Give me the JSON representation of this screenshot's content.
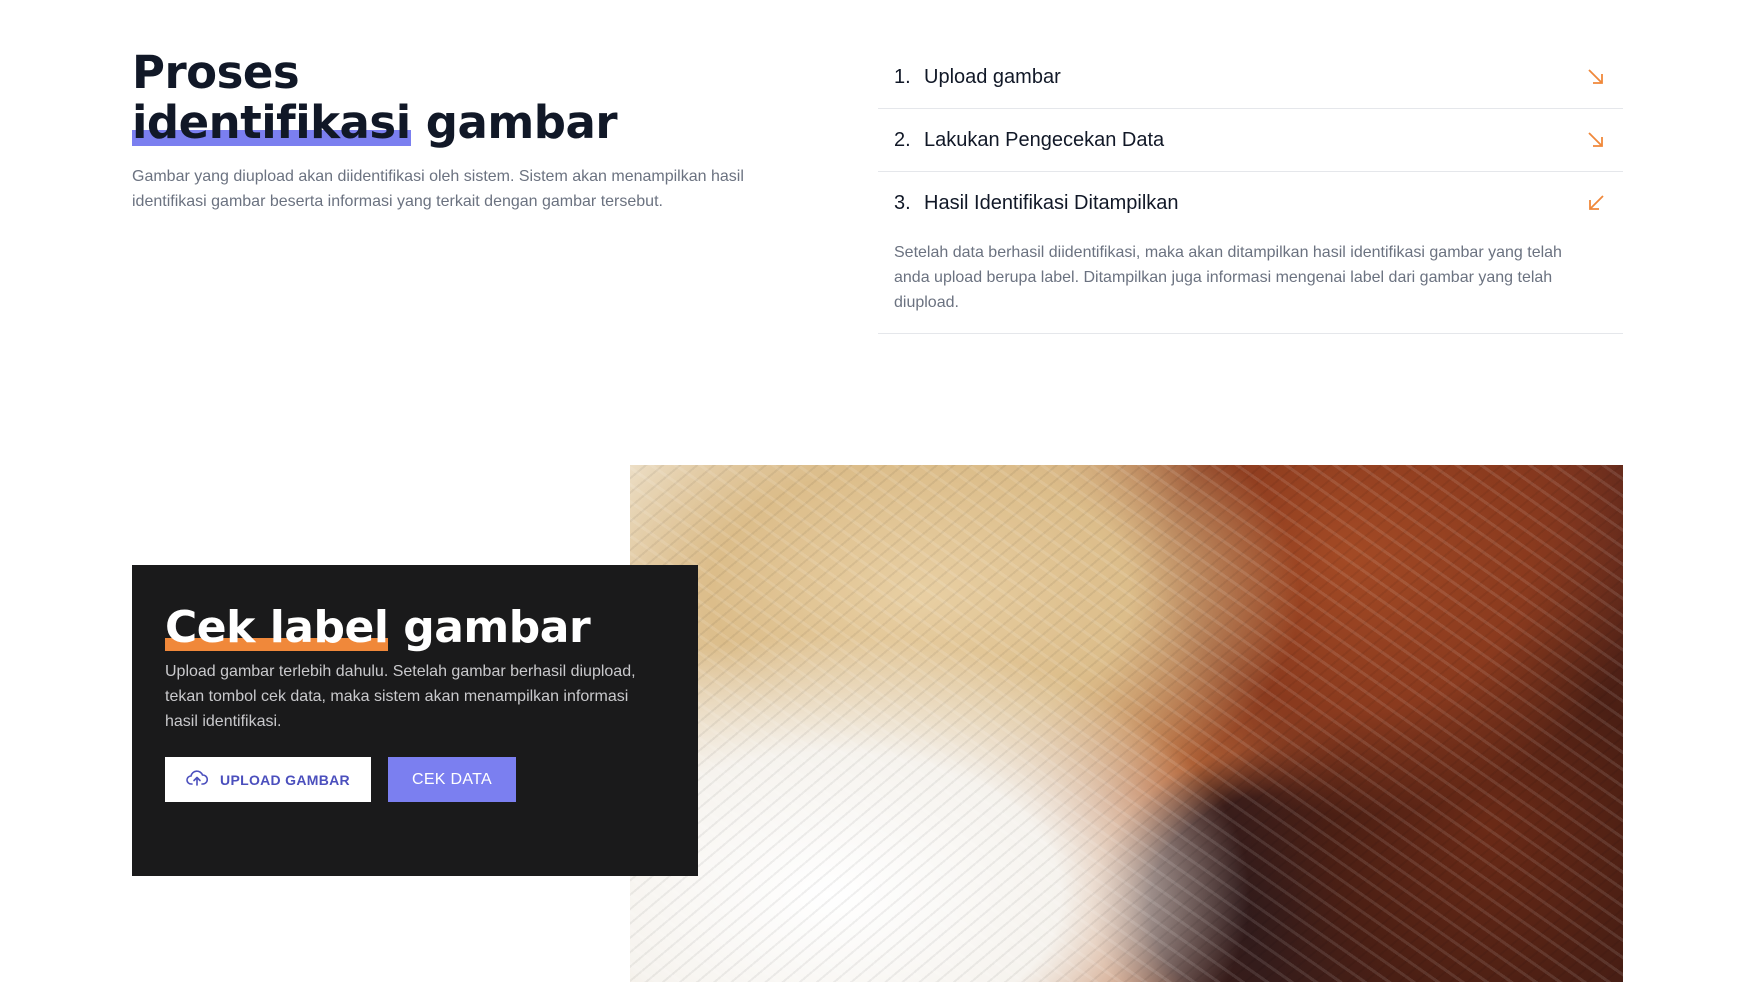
{
  "process": {
    "title_line1": "Proses",
    "title_highlight": "identifikasi",
    "title_rest": " gambar",
    "description": "Gambar yang diupload akan diidentifikasi oleh sistem. Sistem akan menampilkan hasil identifikasi gambar beserta informasi yang terkait dengan gambar tersebut.",
    "steps": [
      {
        "number": "1.",
        "label": "Upload gambar",
        "arrow": "arrow-down-right-icon",
        "open": false
      },
      {
        "number": "2.",
        "label": "Lakukan Pengecekan Data",
        "arrow": "arrow-down-right-icon",
        "open": false
      },
      {
        "number": "3.",
        "label": "Hasil Identifikasi Ditampilkan",
        "arrow": "arrow-down-left-icon",
        "open": true,
        "body": "Setelah data berhasil diidentifikasi, maka akan ditampilkan hasil identifikasi gambar yang telah anda upload berupa label. Ditampilkan juga informasi mengenai label dari gambar yang telah diupload."
      }
    ]
  },
  "check": {
    "title_highlight": "Cek label",
    "title_rest": " gambar",
    "description": "Upload gambar terlebih dahulu. Setelah gambar berhasil diupload, tekan tombol cek data, maka sistem akan menampilkan informasi hasil identifikasi.",
    "upload_button": "UPLOAD GAMBAR",
    "upload_icon": "cloud-upload-icon",
    "check_button": "CEK DATA"
  },
  "colors": {
    "accent_purple": "#7b7ff0",
    "accent_orange": "#f0883a",
    "arrow_orange": "#f0883a",
    "card_dark": "#1a1a1b"
  }
}
